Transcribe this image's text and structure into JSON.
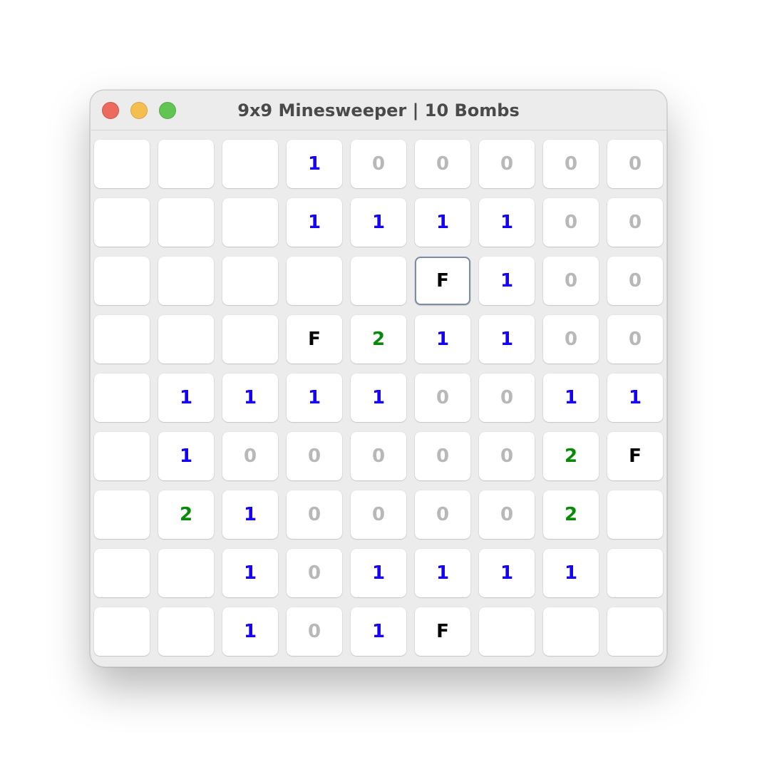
{
  "window": {
    "title": "9x9 Minesweeper | 10 Bombs"
  },
  "colors": {
    "one": "#1500ff",
    "two": "#078a07",
    "zero": "#b8b8b8",
    "flag": "#000000"
  },
  "board": {
    "focused": [
      2,
      5
    ],
    "rows": [
      [
        "",
        "",
        "",
        "1",
        "0",
        "0",
        "0",
        "0",
        "0"
      ],
      [
        "",
        "",
        "",
        "1",
        "1",
        "1",
        "1",
        "0",
        "0"
      ],
      [
        "",
        "",
        "",
        "",
        "",
        "F",
        "1",
        "0",
        "0"
      ],
      [
        "",
        "",
        "",
        "F",
        "2",
        "1",
        "1",
        "0",
        "0"
      ],
      [
        "",
        "1",
        "1",
        "1",
        "1",
        "0",
        "0",
        "1",
        "1"
      ],
      [
        "",
        "1",
        "0",
        "0",
        "0",
        "0",
        "0",
        "2",
        "F"
      ],
      [
        "",
        "2",
        "1",
        "0",
        "0",
        "0",
        "0",
        "2",
        ""
      ],
      [
        "",
        "",
        "1",
        "0",
        "1",
        "1",
        "1",
        "1",
        ""
      ],
      [
        "",
        "",
        "1",
        "0",
        "1",
        "F",
        "",
        "",
        ""
      ]
    ]
  }
}
